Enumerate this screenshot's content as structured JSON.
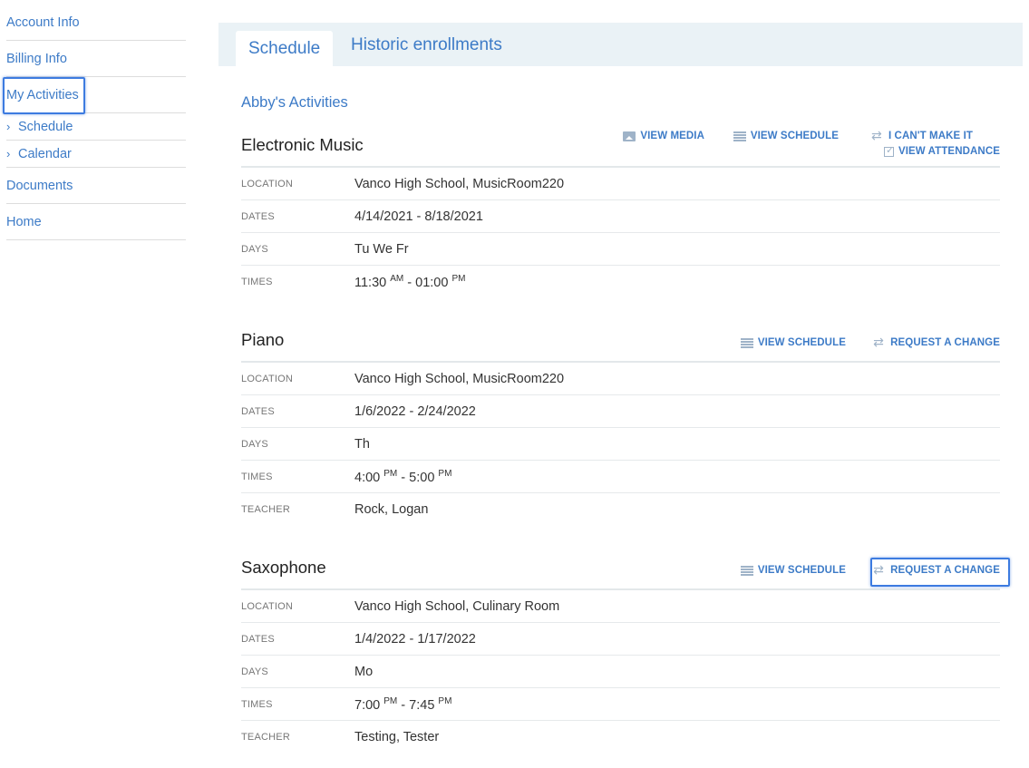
{
  "sidebar": {
    "account_info": "Account Info",
    "billing_info": "Billing Info",
    "my_activities": "My Activities",
    "schedule": "Schedule",
    "calendar": "Calendar",
    "documents": "Documents",
    "home": "Home",
    "chevron": "›"
  },
  "tabs": {
    "schedule": "Schedule",
    "historic": "Historic enrollments"
  },
  "section_title": "Abby's Activities",
  "links": {
    "view_media": "VIEW MEDIA",
    "view_schedule": "VIEW SCHEDULE",
    "cant_make_it": "I CAN'T MAKE IT",
    "view_attendance": "VIEW ATTENDANCE",
    "request_change": "REQUEST A CHANGE"
  },
  "labels": {
    "location": "LOCATION",
    "dates": "DATES",
    "days": "DAYS",
    "times": "TIMES",
    "teacher": "TEACHER"
  },
  "activities": [
    {
      "name": "Electronic Music",
      "location": "Vanco High School, MusicRoom220",
      "dates": "4/14/2021 - 8/18/2021",
      "days": "Tu We Fr",
      "time_start": "11:30",
      "time_start_ampm": "AM",
      "time_end": "01:00",
      "time_end_ampm": "PM"
    },
    {
      "name": "Piano",
      "location": "Vanco High School, MusicRoom220",
      "dates": "1/6/2022 - 2/24/2022",
      "days": "Th",
      "time_start": "4:00",
      "time_start_ampm": "PM",
      "time_end": "5:00",
      "time_end_ampm": "PM",
      "teacher": "Rock, Logan"
    },
    {
      "name": "Saxophone",
      "location": "Vanco High School, Culinary Room",
      "dates": "1/4/2022 - 1/17/2022",
      "days": "Mo",
      "time_start": "7:00",
      "time_start_ampm": "PM",
      "time_end": "7:45",
      "time_end_ampm": "PM",
      "teacher": "Testing, Tester"
    }
  ],
  "time_separator": " - ",
  "colors": {
    "link": "#3d7bc7",
    "tabbar_bg": "#eaf2f6",
    "highlight": "#3d7be0",
    "icon": "#9fb3c8"
  }
}
